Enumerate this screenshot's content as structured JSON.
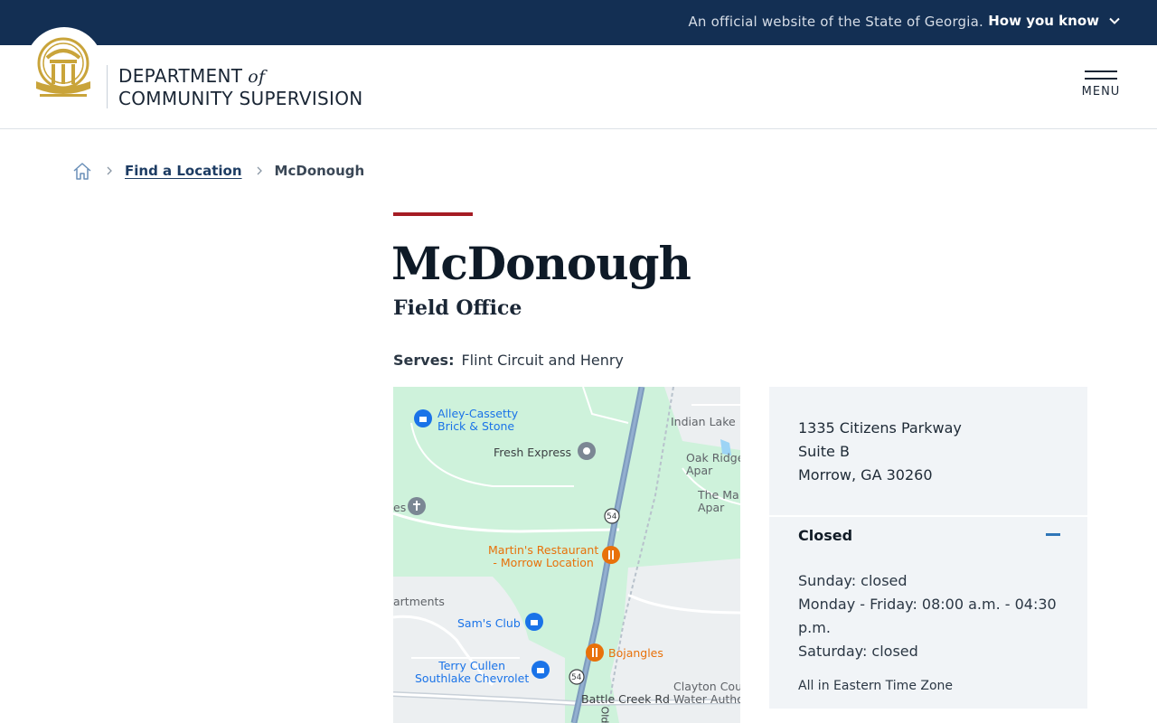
{
  "gov_bar": {
    "official_text": "An official website of the State of Georgia.",
    "how_you_know": "How you know"
  },
  "header": {
    "dept_line1": "DEPARTMENT",
    "dept_of": "of",
    "dept_line2": "COMMUNITY SUPERVISION",
    "menu_label": "MENU"
  },
  "breadcrumb": {
    "link": "Find a Location",
    "current": "McDonough"
  },
  "page": {
    "title": "McDonough",
    "subtitle": "Field Office",
    "serves_label": "Serves:",
    "serves_value": "Flint Circuit and Henry"
  },
  "map": {
    "labels": {
      "alley": "Alley-Cassetty\nBrick & Stone",
      "fresh": "Fresh Express",
      "indian": "Indian Lake",
      "oak": "Oak Ridge\nApar",
      "mar": "The Ma\nApar",
      "es": "es",
      "martins": "Martin's Restaurant\n- Morrow Location",
      "apartments": "artments",
      "sams": "Sam's Club",
      "terry": "Terry Cullen\nSouthlake Chevrolet",
      "bojangles": "Bojangles",
      "clayton": "Clayton Cou\nWater Autho",
      "battle": "Battle Creek Rd",
      "old": "Old",
      "route1": "54",
      "route2": "54"
    }
  },
  "info": {
    "address_line1": "1335 Citizens Parkway",
    "address_line2": "Suite B",
    "address_line3": "Morrow, GA 30260",
    "status": "Closed",
    "hours_sunday": "Sunday: closed",
    "hours_weekday": "Monday - Friday: 08:00 a.m. - 04:30 p.m.",
    "hours_saturday": "Saturday: closed",
    "timezone": "All in Eastern Time Zone"
  },
  "colors": {
    "gov_bar": "#132f53",
    "accent_red": "#a51c24",
    "link_blue": "#1d3c63",
    "collapse_blue": "#2f76b8",
    "seal_gold": "#c9a43a",
    "map_green": "#cef2db",
    "card_bg": "#f1f4f7"
  }
}
